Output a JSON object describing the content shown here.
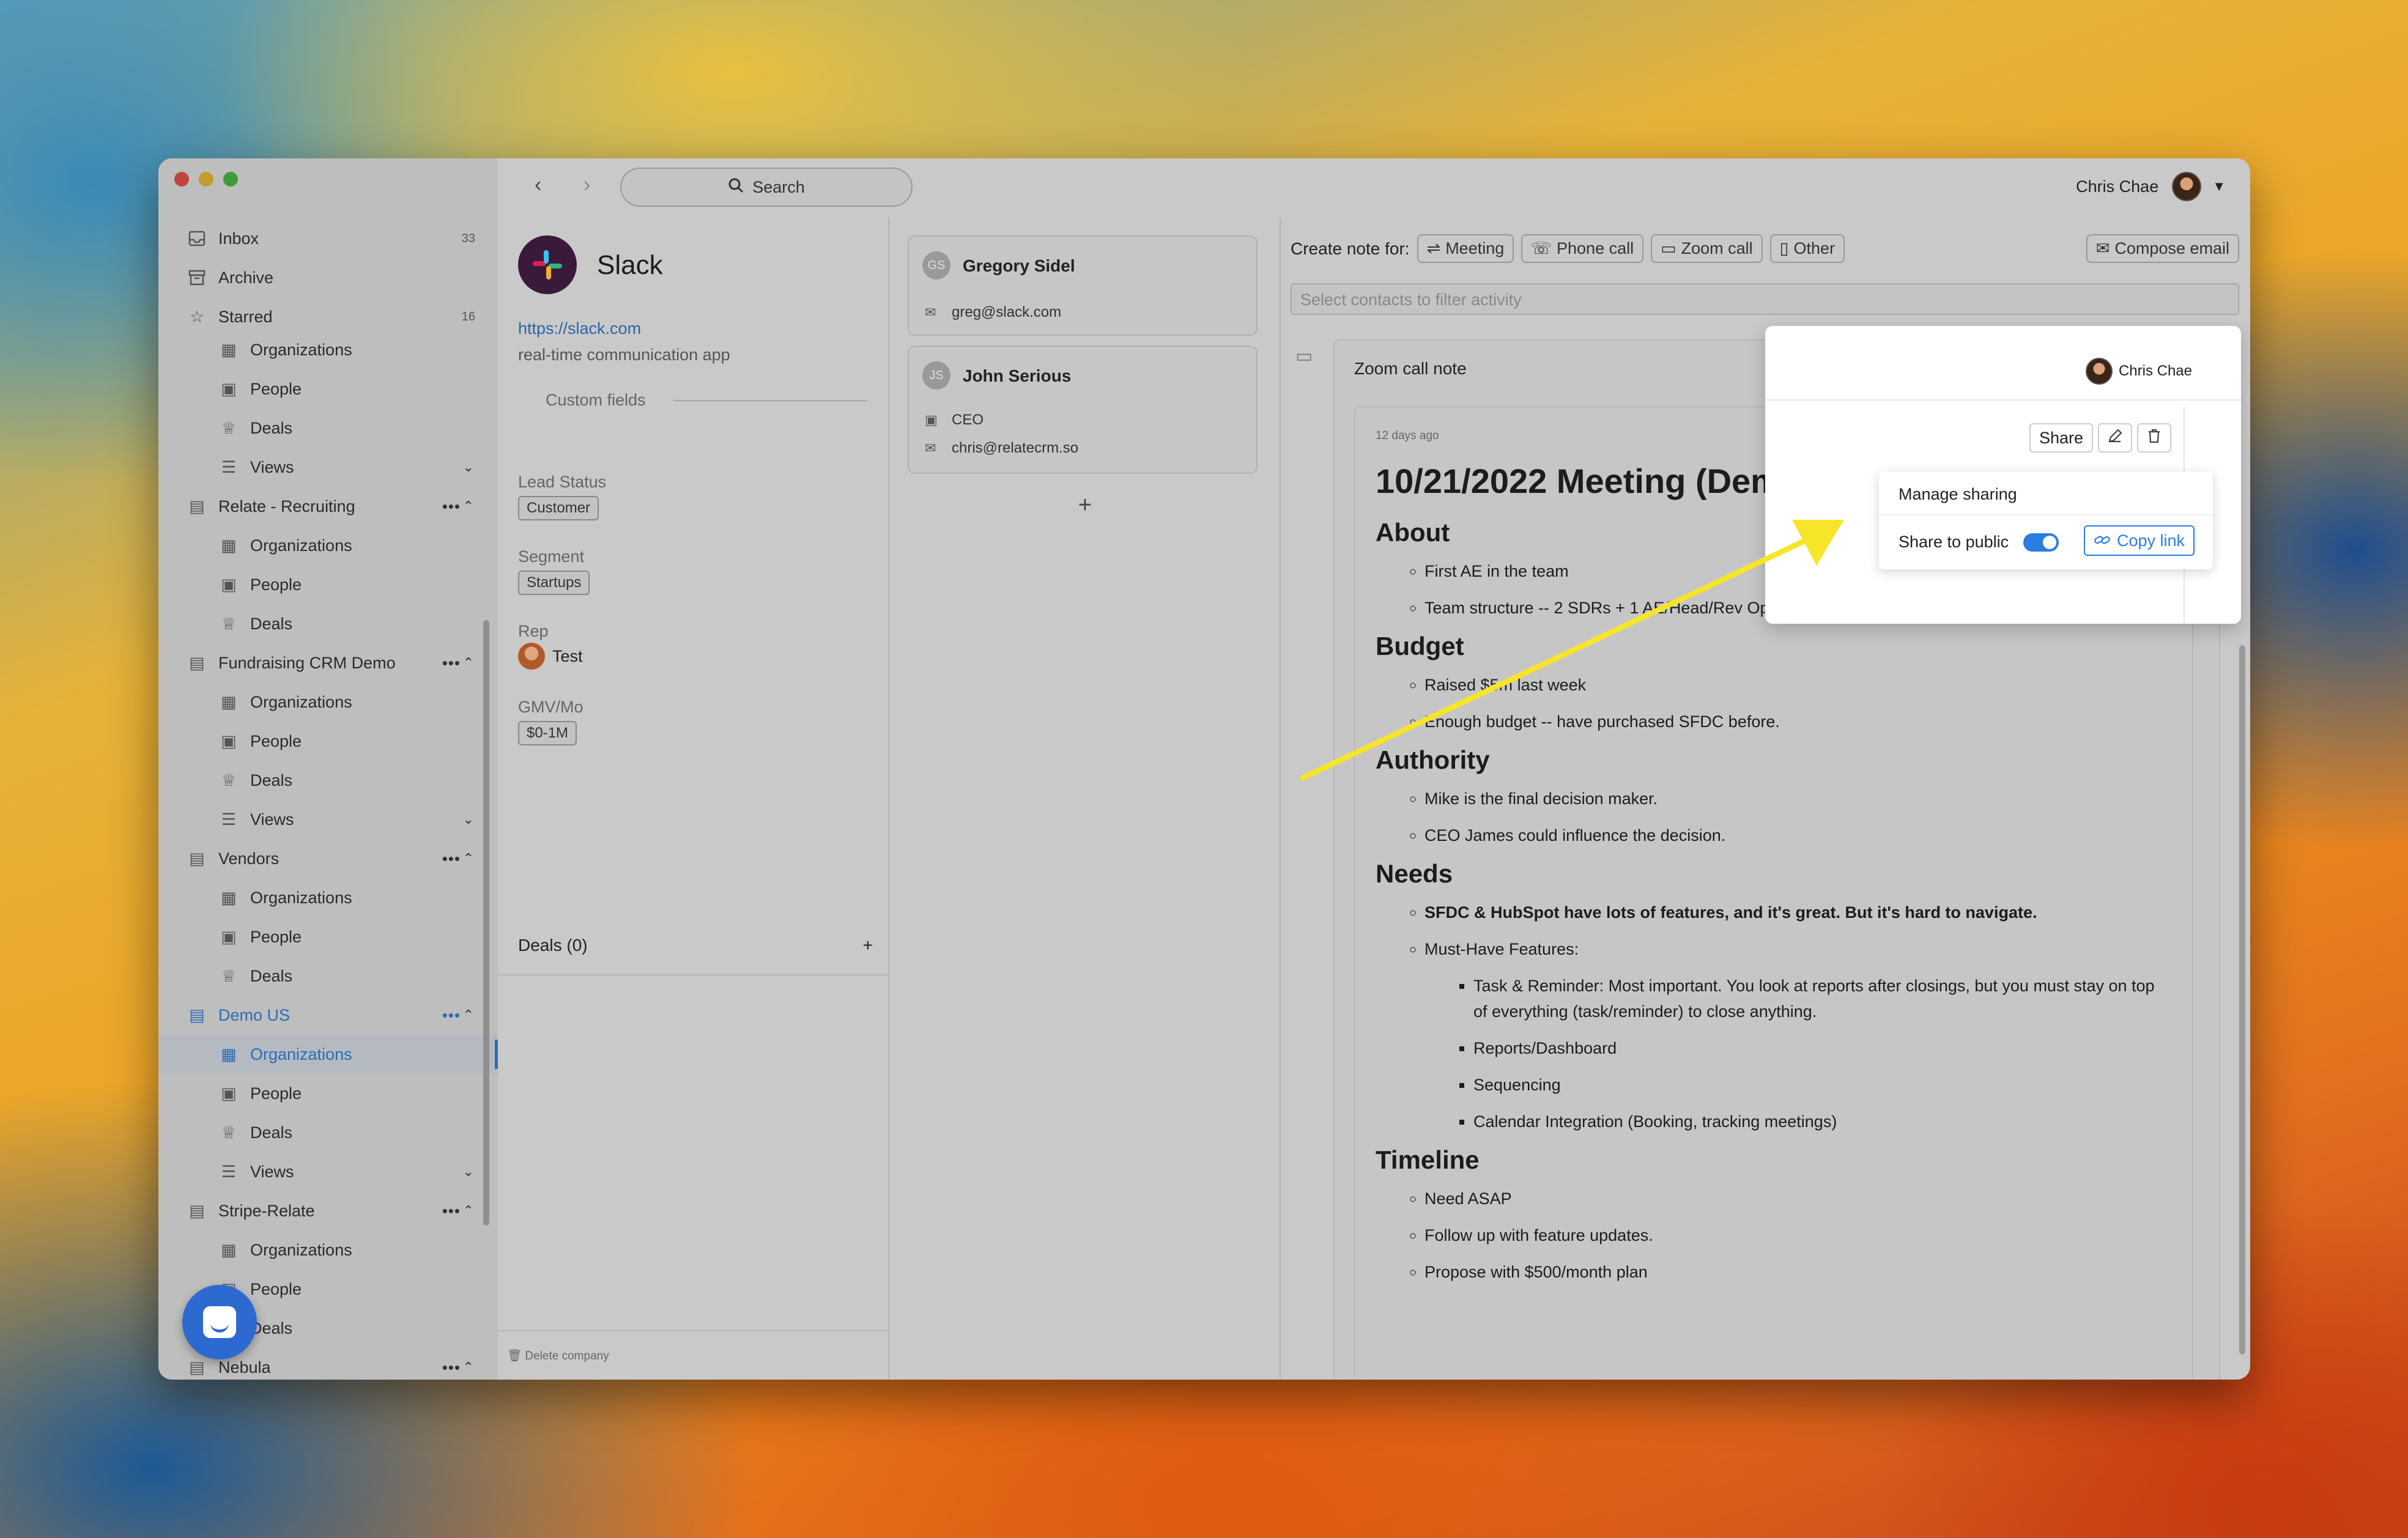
{
  "sidebar": {
    "items": [
      {
        "label": "Inbox",
        "count": "33"
      },
      {
        "label": "Archive"
      },
      {
        "label": "Starred",
        "count": "16"
      },
      {
        "label": "Organizations"
      },
      {
        "label": "People"
      },
      {
        "label": "Deals"
      },
      {
        "label": "Views"
      },
      {
        "label": "Relate - Recruiting",
        "actions": "•••"
      },
      {
        "label": "Organizations"
      },
      {
        "label": "People"
      },
      {
        "label": "Deals"
      },
      {
        "label": "Fundraising CRM Demo",
        "actions": "•••"
      },
      {
        "label": "Organizations"
      },
      {
        "label": "People"
      },
      {
        "label": "Deals"
      },
      {
        "label": "Views"
      },
      {
        "label": "Vendors",
        "actions": "•••"
      },
      {
        "label": "Organizations"
      },
      {
        "label": "People"
      },
      {
        "label": "Deals"
      },
      {
        "label": "Demo US",
        "actions": "•••"
      },
      {
        "label": "Organizations"
      },
      {
        "label": "People"
      },
      {
        "label": "Deals"
      },
      {
        "label": "Views"
      },
      {
        "label": "Stripe-Relate",
        "actions": "•••"
      },
      {
        "label": "Organizations"
      },
      {
        "label": "People"
      },
      {
        "label": "Deals"
      },
      {
        "label": "Nebula",
        "actions": "•••"
      }
    ]
  },
  "topbar": {
    "search_label": "Search",
    "user_name": "Chris Chae"
  },
  "company": {
    "name": "Slack",
    "url": "https://slack.com",
    "description": "real-time communication app",
    "custom_fields_title": "Custom fields",
    "fields": [
      {
        "label": "Lead Status",
        "value": "Customer"
      },
      {
        "label": "Segment",
        "value": "Startups"
      },
      {
        "label": "Rep",
        "value": "Test"
      },
      {
        "label": "GMV/Mo",
        "value": "$0-1M"
      }
    ],
    "deals_label": "Deals (0)",
    "delete_label": "Delete company"
  },
  "contacts": [
    {
      "initials": "GS",
      "name": "Gregory Sidel",
      "email": "greg@slack.com"
    },
    {
      "initials": "JS",
      "name": "John Serious",
      "title": "CEO",
      "email": "chris@relatecrm.so"
    }
  ],
  "notes": {
    "create_label": "Create note for:",
    "types": [
      "Meeting",
      "Phone call",
      "Zoom call",
      "Other"
    ],
    "compose_label": "Compose email",
    "filter_placeholder": "Select contacts to filter activity",
    "card_title": "Zoom call note",
    "time_ago": "12 days ago",
    "title": "10/21/2022 Meeting (Demo)",
    "sections": [
      {
        "heading": "About",
        "items": [
          "First AE in the team",
          "Team structure -- 2 SDRs + 1 AE/Head/Rev Ops (Mike)"
        ]
      },
      {
        "heading": "Budget",
        "items": [
          "Raised $5m last week",
          "Enough budget -- have purchased SFDC before."
        ]
      },
      {
        "heading": "Authority",
        "items": [
          "Mike is the final decision maker.",
          "CEO James could influence the decision."
        ]
      },
      {
        "heading": "Needs",
        "items": [
          "SFDC & HubSpot have lots of features, and it's great. But it's hard to navigate.",
          "Must-Have Features:"
        ],
        "subitems": [
          "Task & Reminder: Most important. You look at reports after closings, but you must stay on top of everything (task/reminder) to close anything.",
          "Reports/Dashboard",
          "Sequencing",
          "Calendar Integration (Booking, tracking meetings)"
        ]
      },
      {
        "heading": "Timeline",
        "items": [
          "Need ASAP",
          "Follow up with feature updates.",
          "Propose with $500/month plan"
        ]
      }
    ]
  },
  "sharing": {
    "share_label": "Share",
    "menu_title": "Manage sharing",
    "public_label": "Share to public",
    "public_on": true,
    "copy_label": "Copy link"
  },
  "colors": {
    "accent": "#2a7de1",
    "arrow": "#f7e52a",
    "link": "#2a66a8"
  }
}
